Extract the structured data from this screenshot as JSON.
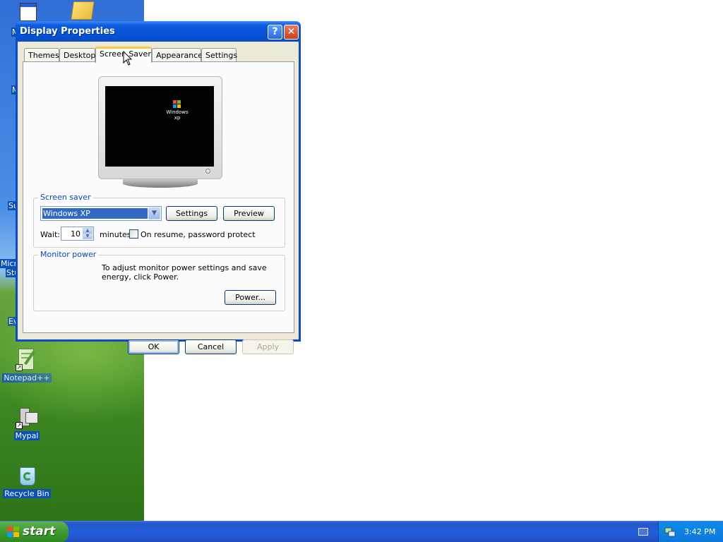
{
  "desktop": {
    "icons": [
      {
        "label": "Notepad++"
      },
      {
        "label": "Mypal"
      },
      {
        "label": "Recycle Bin"
      }
    ],
    "partial_labels": [
      "M",
      "M",
      "Su",
      "Micro",
      "Stu",
      "Ev"
    ]
  },
  "window": {
    "title": "Display Properties",
    "help_glyph": "?",
    "close_glyph": "✕",
    "tabs": [
      {
        "label": "Themes",
        "active": false
      },
      {
        "label": "Desktop",
        "active": false
      },
      {
        "label": "Screen Saver",
        "active": true
      },
      {
        "label": "Appearance",
        "active": false
      },
      {
        "label": "Settings",
        "active": false
      }
    ],
    "preview": {
      "logo_text": "Windows xp"
    },
    "screen_saver": {
      "group_title": "Screen saver",
      "selected": "Windows XP",
      "settings_label": "Settings",
      "preview_label": "Preview",
      "wait_label": "Wait:",
      "wait_value": "10",
      "minutes_label": "minutes",
      "password_protect_label": "On resume, password protect",
      "password_protect_checked": false
    },
    "monitor_power": {
      "group_title": "Monitor power",
      "description": "To adjust monitor power settings and save energy, click Power.",
      "power_label": "Power..."
    },
    "buttons": {
      "ok": "OK",
      "cancel": "Cancel",
      "apply": "Apply"
    }
  },
  "taskbar": {
    "start_label": "start",
    "clock": "3:42 PM"
  },
  "colors": {
    "title_bar": "#0553d6",
    "taskbar": "#245edb",
    "start_button": "#3c9a2f",
    "selection": "#316ac5",
    "group_title": "#0046d5"
  },
  "icon_names": [
    "help-icon",
    "close-icon",
    "chevron-down-icon",
    "spin-up-icon",
    "spin-down-icon",
    "windows-flag-icon",
    "keyboard-icon",
    "network-icon",
    "mouse-cursor-icon"
  ]
}
